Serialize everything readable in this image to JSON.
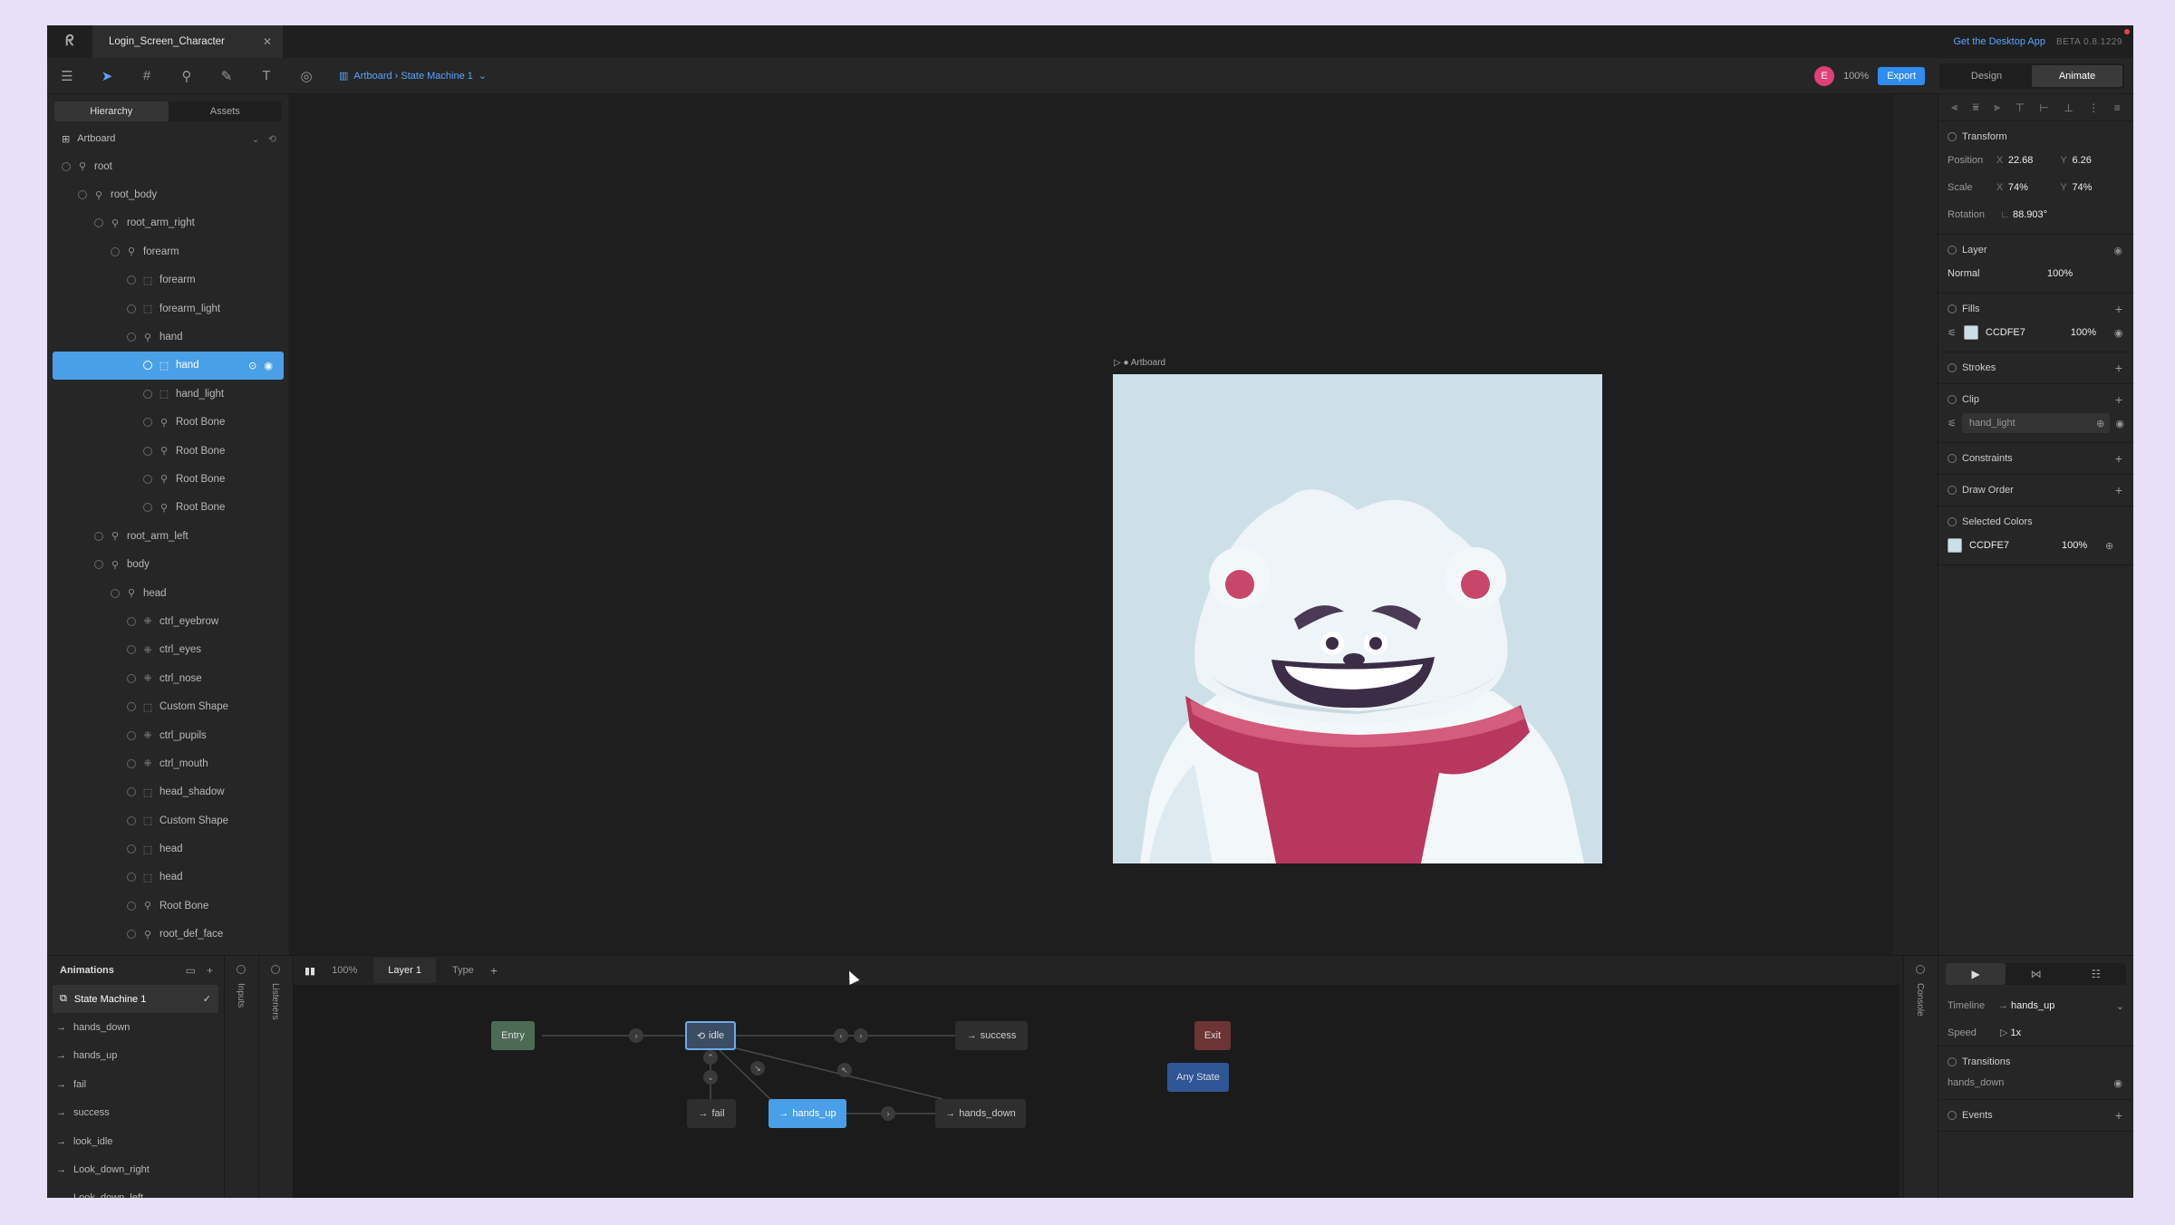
{
  "titlebar": {
    "doc_title": "Login_Screen_Character",
    "desktop_link": "Get the Desktop App",
    "version": "BETA 0.8.1229"
  },
  "toolbar": {
    "breadcrumb": "Artboard › State Machine 1",
    "avatar_initial": "E",
    "zoom": "100%",
    "export_label": "Export",
    "mode_design": "Design",
    "mode_animate": "Animate"
  },
  "left_panel": {
    "tab_hierarchy": "Hierarchy",
    "tab_assets": "Assets",
    "artboard_label": "Artboard",
    "tree": [
      {
        "label": "root",
        "depth": 0,
        "icon": "bone"
      },
      {
        "label": "root_body",
        "depth": 1,
        "icon": "bone"
      },
      {
        "label": "root_arm_right",
        "depth": 2,
        "icon": "bone"
      },
      {
        "label": "forearm",
        "depth": 3,
        "icon": "bone"
      },
      {
        "label": "forearm",
        "depth": 4,
        "icon": "shape"
      },
      {
        "label": "forearm_light",
        "depth": 4,
        "icon": "shape"
      },
      {
        "label": "hand",
        "depth": 4,
        "icon": "bone"
      },
      {
        "label": "hand",
        "depth": 5,
        "icon": "shape",
        "selected": true
      },
      {
        "label": "hand_light",
        "depth": 5,
        "icon": "shape"
      },
      {
        "label": "Root Bone",
        "depth": 5,
        "icon": "bone"
      },
      {
        "label": "Root Bone",
        "depth": 5,
        "icon": "bone"
      },
      {
        "label": "Root Bone",
        "depth": 5,
        "icon": "bone"
      },
      {
        "label": "Root Bone",
        "depth": 5,
        "icon": "bone"
      },
      {
        "label": "root_arm_left",
        "depth": 2,
        "icon": "bone"
      },
      {
        "label": "body",
        "depth": 2,
        "icon": "bone"
      },
      {
        "label": "head",
        "depth": 3,
        "icon": "bone"
      },
      {
        "label": "ctrl_eyebrow",
        "depth": 4,
        "icon": "ctrl"
      },
      {
        "label": "ctrl_eyes",
        "depth": 4,
        "icon": "ctrl"
      },
      {
        "label": "ctrl_nose",
        "depth": 4,
        "icon": "ctrl"
      },
      {
        "label": "Custom Shape",
        "depth": 4,
        "icon": "shape"
      },
      {
        "label": "ctrl_pupils",
        "depth": 4,
        "icon": "ctrl"
      },
      {
        "label": "ctrl_mouth",
        "depth": 4,
        "icon": "ctrl"
      },
      {
        "label": "head_shadow",
        "depth": 4,
        "icon": "shape"
      },
      {
        "label": "Custom Shape",
        "depth": 4,
        "icon": "shape"
      },
      {
        "label": "head",
        "depth": 4,
        "icon": "shape"
      },
      {
        "label": "head",
        "depth": 4,
        "icon": "shape"
      },
      {
        "label": "Root Bone",
        "depth": 4,
        "icon": "bone"
      },
      {
        "label": "root_def_face",
        "depth": 4,
        "icon": "bone"
      }
    ]
  },
  "canvas": {
    "artboard_label": "Artboard",
    "artboard_bg": "#CDE0E8"
  },
  "inspector": {
    "transform": {
      "title": "Transform",
      "position_label": "Position",
      "pos_x": "22.68",
      "pos_y": "6.26",
      "scale_label": "Scale",
      "scale_x": "74%",
      "scale_y": "74%",
      "rotation_label": "Rotation",
      "rotation": "88.903°",
      "x": "X",
      "y": "Y"
    },
    "layer": {
      "title": "Layer",
      "blend": "Normal",
      "opacity": "100%"
    },
    "fills": {
      "title": "Fills",
      "hex": "CCDFE7",
      "opacity": "100%",
      "color": "#CCDFE7"
    },
    "strokes": {
      "title": "Strokes"
    },
    "clip": {
      "title": "Clip",
      "value": "hand_light"
    },
    "constraints": {
      "title": "Constraints"
    },
    "draw_order": {
      "title": "Draw Order"
    },
    "selected_colors": {
      "title": "Selected Colors",
      "hex": "CCDFE7",
      "opacity": "100%"
    }
  },
  "bottom": {
    "animations_title": "Animations",
    "animations": [
      {
        "label": "State Machine 1",
        "active": true
      },
      {
        "label": "hands_down"
      },
      {
        "label": "hands_up"
      },
      {
        "label": "fail"
      },
      {
        "label": "success"
      },
      {
        "label": "look_idle"
      },
      {
        "label": "Look_down_right"
      },
      {
        "label": "Look_down_left"
      }
    ],
    "inputs_tab": "Inputs",
    "listeners_tab": "Listeners",
    "console_tab": "Console",
    "sm_zoom": "100%",
    "sm_layer": "Layer 1",
    "sm_type": "Type",
    "nodes": {
      "entry": "Entry",
      "idle": "idle",
      "success": "success",
      "exit": "Exit",
      "any_state": "Any State",
      "fail": "fail",
      "hands_up": "hands_up",
      "hands_down": "hands_down"
    },
    "timeline": {
      "label": "Timeline",
      "value": "hands_up",
      "speed_label": "Speed",
      "speed": "1x"
    },
    "transitions": {
      "title": "Transitions",
      "item": "hands_down"
    },
    "events": {
      "title": "Events"
    }
  }
}
